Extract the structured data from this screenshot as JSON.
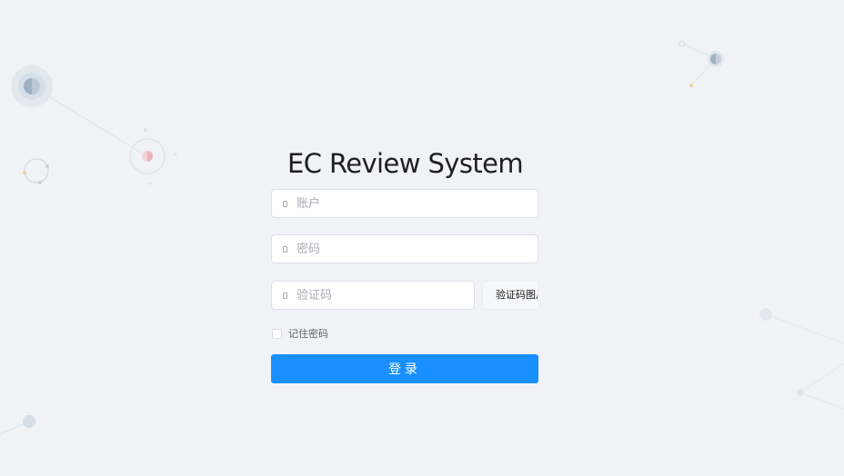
{
  "app": {
    "title": "EC Review System"
  },
  "form": {
    "username": {
      "value": "",
      "placeholder": "账户",
      "icon": "user-icon"
    },
    "password": {
      "value": "",
      "placeholder": "密码",
      "icon": "lock-icon"
    },
    "captcha": {
      "value": "",
      "placeholder": "验证码",
      "icon": "key-icon",
      "image_alt_text": "验证码图片"
    },
    "remember": {
      "label": "记住密码",
      "checked": false
    },
    "submit_label": "登录"
  },
  "colors": {
    "background": "#f0f2f5",
    "primary": "#1890ff",
    "border": "#dcdfe6",
    "placeholder": "#a8abb2",
    "title_text": "#1f1f1f"
  }
}
